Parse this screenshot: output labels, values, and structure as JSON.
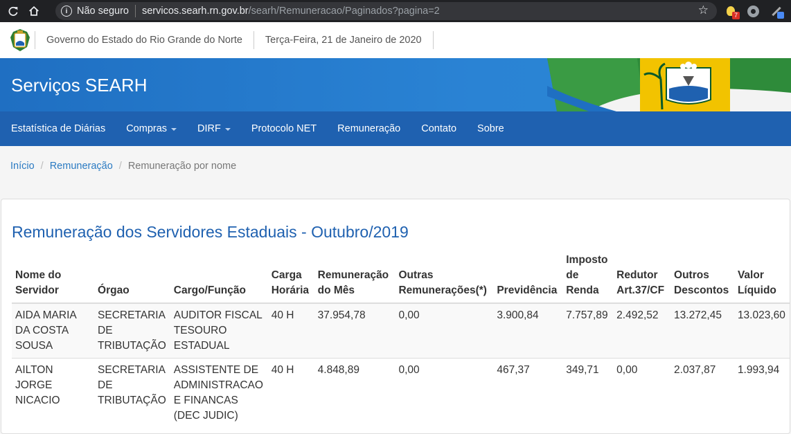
{
  "browser": {
    "security_label": "Não seguro",
    "url_host": "servicos.searh.rn.gov.br",
    "url_path": "/searh/Remuneracao/Paginados?pagina=2",
    "extension_badge": "7"
  },
  "govbar": {
    "government": "Governo do Estado do Rio Grande do Norte",
    "date": "Terça-Feira, 21 de Janeiro de 2020"
  },
  "banner": {
    "title": "Serviços SEARH"
  },
  "nav": {
    "items": [
      {
        "label": "Estatística de Diárias"
      },
      {
        "label": "Compras"
      },
      {
        "label": "DIRF"
      },
      {
        "label": "Protocolo NET"
      },
      {
        "label": "Remuneração"
      },
      {
        "label": "Contato"
      },
      {
        "label": "Sobre"
      }
    ]
  },
  "breadcrumb": {
    "home": "Início",
    "section": "Remuneração",
    "current": "Remuneração por nome"
  },
  "main": {
    "heading": "Remuneração dos Servidores Estaduais - Outubro/2019",
    "columns": {
      "nome": [
        "Nome do",
        "Servidor"
      ],
      "orgao": "Órgao",
      "cargo": "Cargo/Função",
      "carga": [
        "Carga",
        "Horária"
      ],
      "remuneracao": [
        "Remuneração",
        "do Mês"
      ],
      "outras": [
        "Outras",
        "Remunerações(*)"
      ],
      "previdencia": "Previdência",
      "imposto": [
        "Imposto",
        "de",
        "Renda"
      ],
      "redutor": [
        "Redutor",
        "Art.37/CF"
      ],
      "descontos": [
        "Outros",
        "Descontos"
      ],
      "liquido": [
        "Valor",
        "Líquido"
      ]
    },
    "rows": [
      {
        "nome": [
          "AIDA MARIA",
          "DA COSTA",
          "SOUSA"
        ],
        "orgao": [
          "SECRETARIA",
          "DE",
          "TRIBUTAÇÃO"
        ],
        "cargo": [
          "AUDITOR FISCAL",
          "TESOURO",
          "ESTADUAL"
        ],
        "carga": "40 H",
        "remuneracao": "37.954,78",
        "outras": "0,00",
        "previdencia": "3.900,84",
        "imposto": "7.757,89",
        "redutor": "2.492,52",
        "descontos": "13.272,45",
        "liquido": "13.023,60"
      },
      {
        "nome": [
          "AILTON",
          "JORGE",
          "NICACIO"
        ],
        "orgao": [
          "SECRETARIA",
          "DE",
          "TRIBUTAÇÃO"
        ],
        "cargo": [
          "ASSISTENTE DE",
          "ADMINISTRACAO",
          "E FINANCAS",
          "(DEC JUDIC)"
        ],
        "carga": "40 H",
        "remuneracao": "4.848,89",
        "outras": "0,00",
        "previdencia": "467,37",
        "imposto": "349,71",
        "redutor": "0,00",
        "descontos": "2.037,87",
        "liquido": "1.993,94"
      }
    ]
  }
}
